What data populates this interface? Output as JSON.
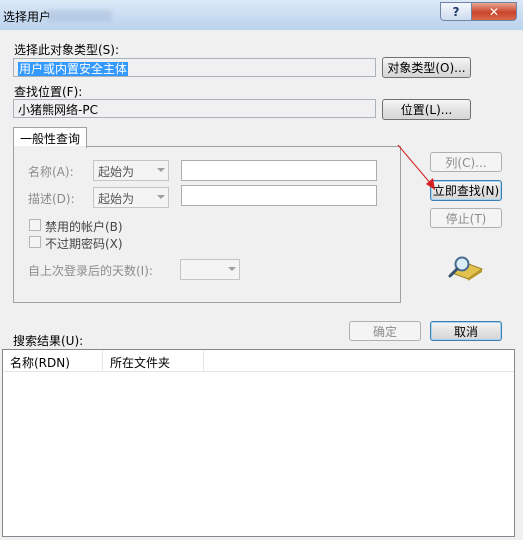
{
  "window": {
    "title": "选择用户",
    "help_glyph": "?",
    "close_glyph": "✕"
  },
  "object_type": {
    "label": "选择此对象类型(S):",
    "value": "用户或内置安全主体",
    "button": "对象类型(O)..."
  },
  "location": {
    "label": "查找位置(F):",
    "value": "小猪熊网络-PC",
    "button": "位置(L)..."
  },
  "tab": {
    "label": "一般性查询"
  },
  "query": {
    "name_label": "名称(A):",
    "name_combo": "起始为",
    "desc_label": "描述(D):",
    "desc_combo": "起始为",
    "disabled_accounts": "禁用的帐户(B)",
    "no_expire_password": "不过期密码(X)",
    "days_since_logon": "自上次登录后的天数(I):"
  },
  "side_buttons": {
    "columns": "列(C)...",
    "find_now": "立即查找(N)",
    "stop": "停止(T)"
  },
  "actions": {
    "ok": "确定",
    "cancel": "取消"
  },
  "results": {
    "label": "搜索结果(U):",
    "columns": [
      "名称(RDN)",
      "所在文件夹"
    ]
  },
  "colors": {
    "selection": "#3399ff",
    "annotation_arrow": "#d42020"
  }
}
